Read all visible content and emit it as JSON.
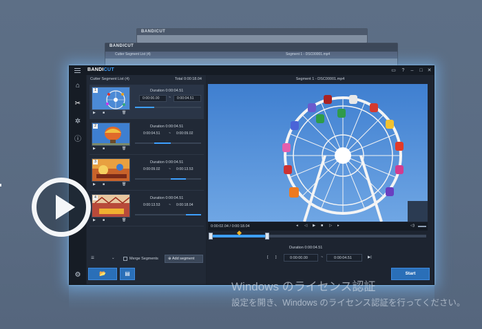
{
  "app": {
    "brand_a": "BANDI",
    "brand_b": "CUT"
  },
  "ghost_windows": {
    "back_title": "BANDICUT",
    "mid_title": "BANDICUT",
    "mid_list_head": "Cutter Segment List (4)",
    "mid_preview_head": "Segment 1 - DSC00001.mp4"
  },
  "segment_list": {
    "header": "Cutter Segment List (4)",
    "total": "Total 0:00:18.04",
    "segments": [
      {
        "num": "1",
        "duration": "Duration 0:00:04.51",
        "start": "0:00:00.00",
        "end": "0:00:04.51",
        "progress": 0.3
      },
      {
        "num": "2",
        "duration": "Duration 0:00:04.51",
        "start": "0:00:04.51",
        "end": "0:00:09.02",
        "progress": 0.45
      },
      {
        "num": "3",
        "duration": "Duration 0:00:04.51",
        "start": "0:00:09.02",
        "end": "0:00:13.53",
        "progress": 0.7
      },
      {
        "num": "4",
        "duration": "Duration 0:00:04.51",
        "start": "0:00:13.53",
        "end": "0:00:18.04",
        "progress": 0.95
      }
    ],
    "merge_label": "Merge Segments",
    "add_segment_label": "Add segment"
  },
  "preview": {
    "header": "Segment 1 - DSC00001.mp4",
    "time_readout": "0:00:02.04 / 0:00:18.04",
    "duration": "Duration 0:00:04.51",
    "start": "0:00:00.00",
    "end": "0:00:04.51",
    "start_button": "Start"
  },
  "watermark": {
    "line1": "Windows のライセンス認証",
    "line2": "設定を開き、Windows のライセンス認証を行ってください。"
  },
  "colors": {
    "accent": "#3ea0ff",
    "button": "#2a6fb8"
  }
}
